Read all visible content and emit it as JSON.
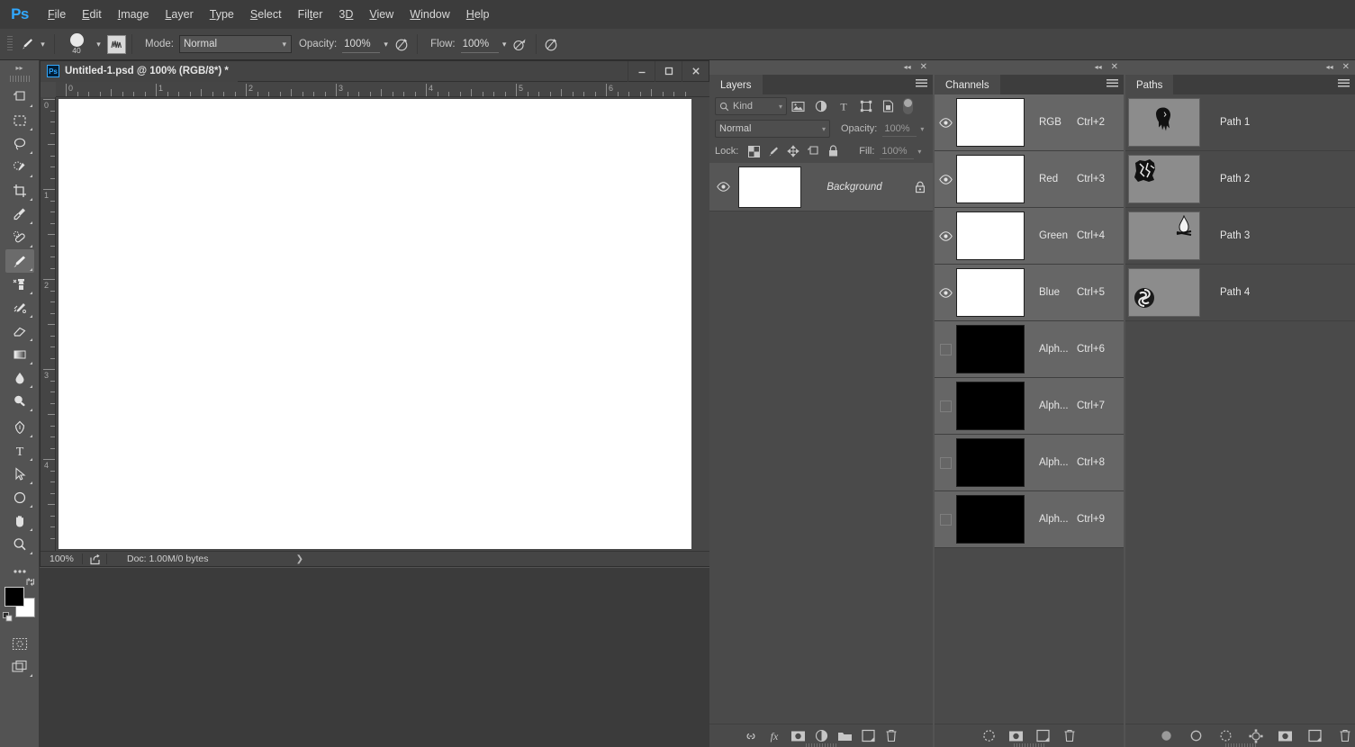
{
  "app": {
    "logo": "Ps",
    "menu": [
      "File",
      "Edit",
      "Image",
      "Layer",
      "Type",
      "Select",
      "Filter",
      "3D",
      "View",
      "Window",
      "Help"
    ]
  },
  "options_bar": {
    "tool_icon": "brush-icon",
    "brush_size": "40",
    "tool_preset_icon": "tool-preset-icon",
    "mode_label": "Mode:",
    "mode_value": "Normal",
    "opacity_label": "Opacity:",
    "opacity_value": "100%",
    "airbrush_icon": "airbrush-icon",
    "flow_label": "Flow:",
    "flow_value": "100%",
    "smoothing_icon": "smoothing-icon",
    "pressure_icon": "pressure-size-icon"
  },
  "toolbar": {
    "collapse_icon": "double-chevron-right-icon",
    "tools": [
      {
        "name": "artboard-tool",
        "active": false
      },
      {
        "name": "rectangular-marquee-tool",
        "active": false
      },
      {
        "name": "lasso-tool",
        "active": false
      },
      {
        "name": "quick-selection-tool",
        "active": false
      },
      {
        "name": "crop-tool",
        "active": false
      },
      {
        "name": "eyedropper-tool",
        "active": false
      },
      {
        "name": "spot-healing-brush-tool",
        "active": false
      },
      {
        "name": "brush-tool",
        "active": true
      },
      {
        "name": "clone-stamp-tool",
        "active": false
      },
      {
        "name": "history-brush-tool",
        "active": false
      },
      {
        "name": "eraser-tool",
        "active": false
      },
      {
        "name": "gradient-tool",
        "active": false
      },
      {
        "name": "blur-tool",
        "active": false
      },
      {
        "name": "dodge-tool",
        "active": false
      },
      {
        "name": "pen-tool",
        "active": false
      },
      {
        "name": "horizontal-type-tool",
        "active": false
      },
      {
        "name": "path-selection-tool",
        "active": false
      },
      {
        "name": "ellipse-tool",
        "active": false
      },
      {
        "name": "hand-tool",
        "active": false
      },
      {
        "name": "zoom-tool",
        "active": false
      },
      {
        "name": "edit-toolbar-tool",
        "active": false
      }
    ],
    "foreground_color": "#000000",
    "background_color": "#ffffff",
    "quick_mask_icon": "quick-mask-icon",
    "screen_mode_icon": "screen-mode-icon"
  },
  "document": {
    "title": "Untitled-1.psd @ 100% (RGB/8*) *",
    "badge": "Ps",
    "window_buttons": [
      "minimize",
      "maximize",
      "close"
    ],
    "ruler_h_labels": [
      "0",
      "1",
      "2",
      "3",
      "4",
      "5",
      "6"
    ],
    "ruler_v_labels": [
      "0",
      "1",
      "2",
      "3",
      "4"
    ],
    "status": {
      "zoom": "100%",
      "export_icon": "share-export-icon",
      "doc_info": "Doc: 1.00M/0 bytes",
      "expand_icon": "chevron-right-icon"
    }
  },
  "layers_panel": {
    "tab": "Layers",
    "collapse_icon": "double-chevron-left-icon",
    "close_icon": "close-icon",
    "menu_icon": "panel-menu-icon",
    "filter_kind": "Kind",
    "filter_search_icon": "search-icon",
    "filter_icons": [
      "pixel-filter-icon",
      "adjustment-filter-icon",
      "type-filter-icon",
      "shape-filter-icon",
      "smart-object-filter-icon"
    ],
    "filter_toggle": "filter-enable-toggle",
    "blend_mode": "Normal",
    "opacity_label": "Opacity:",
    "opacity_value": "100%",
    "lock_label": "Lock:",
    "lock_icons": [
      "lock-transparent-pixels-icon",
      "lock-image-pixels-icon",
      "lock-position-icon",
      "lock-artboard-nesting-icon",
      "lock-all-icon"
    ],
    "fill_label": "Fill:",
    "fill_value": "100%",
    "layers": [
      {
        "name": "Background",
        "visible": true,
        "locked": true,
        "thumb_color": "#ffffff"
      }
    ],
    "footer_buttons": [
      {
        "name": "link-layers-button",
        "icon": "link-icon"
      },
      {
        "name": "layer-style-button",
        "icon": "fx-icon"
      },
      {
        "name": "add-layer-mask-button",
        "icon": "layer-mask-icon"
      },
      {
        "name": "new-adjustment-layer-button",
        "icon": "half-circle-icon"
      },
      {
        "name": "new-group-button",
        "icon": "folder-icon"
      },
      {
        "name": "new-layer-button",
        "icon": "new-layer-icon"
      },
      {
        "name": "delete-layer-button",
        "icon": "trash-icon"
      }
    ]
  },
  "channels_panel": {
    "tab": "Channels",
    "collapse_icon": "double-chevron-left-icon",
    "close_icon": "close-icon",
    "menu_icon": "panel-menu-icon",
    "channels": [
      {
        "name": "RGB",
        "shortcut": "Ctrl+2",
        "visible": true,
        "thumb_color": "#ffffff"
      },
      {
        "name": "Red",
        "shortcut": "Ctrl+3",
        "visible": true,
        "thumb_color": "#ffffff"
      },
      {
        "name": "Green",
        "shortcut": "Ctrl+4",
        "visible": true,
        "thumb_color": "#ffffff"
      },
      {
        "name": "Blue",
        "shortcut": "Ctrl+5",
        "visible": true,
        "thumb_color": "#ffffff"
      },
      {
        "name": "Alph...",
        "shortcut": "Ctrl+6",
        "visible": false,
        "thumb_color": "#000000"
      },
      {
        "name": "Alph...",
        "shortcut": "Ctrl+7",
        "visible": false,
        "thumb_color": "#000000"
      },
      {
        "name": "Alph...",
        "shortcut": "Ctrl+8",
        "visible": false,
        "thumb_color": "#000000"
      },
      {
        "name": "Alph...",
        "shortcut": "Ctrl+9",
        "visible": false,
        "thumb_color": "#000000"
      }
    ],
    "footer_buttons": [
      {
        "name": "load-channel-as-selection-button",
        "icon": "dashed-circle-icon"
      },
      {
        "name": "save-selection-as-channel-button",
        "icon": "channel-mask-icon"
      },
      {
        "name": "new-channel-button",
        "icon": "new-layer-icon"
      },
      {
        "name": "delete-channel-button",
        "icon": "trash-icon"
      }
    ]
  },
  "paths_panel": {
    "tab": "Paths",
    "collapse_icon": "double-chevron-left-icon",
    "close_icon": "close-icon",
    "menu_icon": "panel-menu-icon",
    "paths": [
      {
        "name": "Path 1",
        "thumb_shape": "ghost-blob-shape",
        "thumb_pos": "center"
      },
      {
        "name": "Path 2",
        "thumb_shape": "rock-cluster-shape",
        "thumb_pos": "top-left"
      },
      {
        "name": "Path 3",
        "thumb_shape": "campfire-shape",
        "thumb_pos": "top-right"
      },
      {
        "name": "Path 4",
        "thumb_shape": "spiral-shape",
        "thumb_pos": "bottom-left"
      }
    ],
    "footer_buttons": [
      {
        "name": "fill-path-button",
        "icon": "filled-circle-icon"
      },
      {
        "name": "stroke-path-button",
        "icon": "outline-circle-icon"
      },
      {
        "name": "load-path-as-selection-button",
        "icon": "dashed-circle-icon"
      },
      {
        "name": "make-work-path-button",
        "icon": "anchor-points-icon"
      },
      {
        "name": "add-layer-mask-button",
        "icon": "layer-mask-icon"
      },
      {
        "name": "new-path-button",
        "icon": "new-layer-icon"
      },
      {
        "name": "delete-path-button",
        "icon": "trash-icon"
      }
    ]
  },
  "colors": {
    "accent": "#31a8ff",
    "menubar_bg": "#3c3c3c",
    "options_bg": "#454545",
    "panel_bg": "#4a4a4a",
    "app_bg": "#535353",
    "canvas_bg": "#ffffff"
  }
}
